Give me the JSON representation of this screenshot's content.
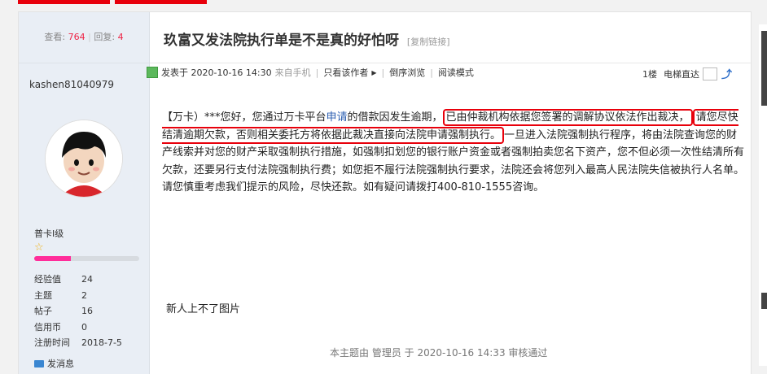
{
  "thread": {
    "views_label": "查看:",
    "views": "764",
    "replies_label": "回复:",
    "replies": "4",
    "title": "玖富又发法院执行单是不是真的好怕呀",
    "copy_link": "[复制链接]"
  },
  "author": {
    "username": "kashen81040979",
    "level": "普卡I级",
    "level_progress": 0.35,
    "stats": [
      {
        "label": "经验值",
        "value": "24"
      },
      {
        "label": "主题",
        "value": "2"
      },
      {
        "label": "帖子",
        "value": "16"
      },
      {
        "label": "信用币",
        "value": "0"
      },
      {
        "label": "注册时间",
        "value": "2018-7-5"
      }
    ],
    "send_message": "发消息"
  },
  "post_meta": {
    "posted": "发表于 2020-10-16 14:30",
    "source": "来自手机",
    "only_author": "只看该作者",
    "reverse": "倒序浏览",
    "reading_mode": "阅读模式",
    "floor": "1楼",
    "elevator": "电梯直达"
  },
  "body": {
    "p1": "【万卡）***您好，您通过万卡平台",
    "link": "申请",
    "p2": "的借款因发生逾期，",
    "highlight1": "已由仲裁机构依据您签署的调解协议依法作出裁决，",
    "highlight2": "请您尽快结清逾期欠款，否则相关委托方将依据此裁决直接向法院申请强制执行。",
    "p3": "一旦进入法院强制执行程序，将由法院查询您的财产线索并对您的财产采取强制执行措施，如强制扣划您的银行账户资金或者强制拍卖您名下资产，您不但必须一次性结清所有欠款，还要另行支付法院强制执行费；如您拒不履行法院强制执行要求，法院还会将您列入最高人民法院失信被执行人名单。请您慎重考虑我们提示的风险，尽快还款。如有疑问请拨打400-810-1555咨询。",
    "note": "新人上不了图片"
  },
  "audit": "本主题由 管理员 于 2020-10-16 14:33 审核通过",
  "colors": {
    "accent": "#e8000b",
    "link": "#2a5db0",
    "bar": "#ff2d9a"
  }
}
